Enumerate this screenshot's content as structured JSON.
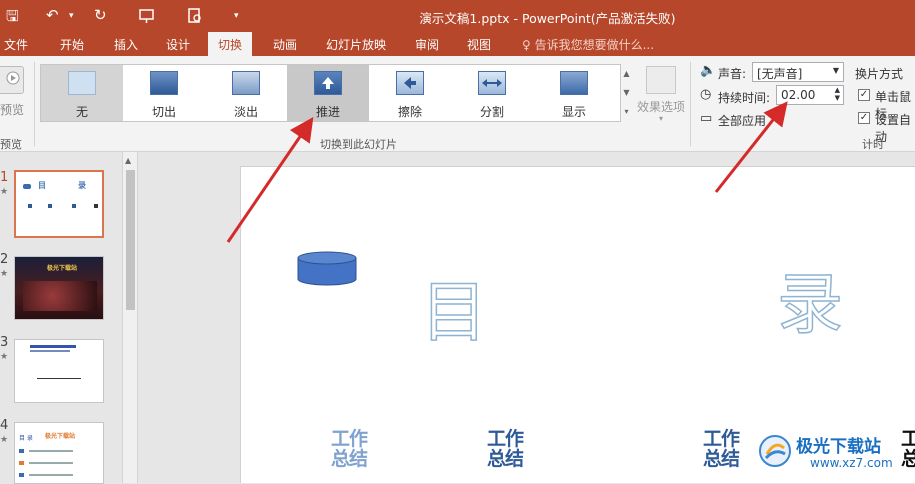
{
  "titlebar": {
    "title": "演示文稿1.pptx - PowerPoint(产品激活失败)",
    "quick_access": {
      "save": "🖫",
      "undo": "↶",
      "undo_dropdown": "▾",
      "redo": "↻",
      "customize": "▾"
    }
  },
  "tabs": [
    "文件",
    "开始",
    "插入",
    "设计",
    "切换",
    "动画",
    "幻灯片放映",
    "审阅",
    "视图"
  ],
  "active_tab": "切换",
  "tellme": "♀ 告诉我您想要做什么...",
  "ribbon": {
    "preview": {
      "label": "预览",
      "group_label": "预览"
    },
    "transitions": [
      "无",
      "切出",
      "淡出",
      "推进",
      "擦除",
      "分割",
      "显示"
    ],
    "selected_transition": "推进",
    "effect_options": "效果选项",
    "group_label": "切换到此幻灯片",
    "timing": {
      "sound_label": "声音:",
      "sound_value": "[无声音]",
      "duration_label": "持续时间:",
      "duration_value": "02.00",
      "apply_all": "全部应用",
      "advance_label": "换片方式",
      "on_click": "单击鼠标",
      "after": "设置自动",
      "group_label": "计时"
    }
  },
  "slides": [
    {
      "number": "1",
      "star": "★",
      "title_a": "目",
      "title_b": "录"
    },
    {
      "number": "2",
      "star": "★",
      "title": "极光下载站"
    },
    {
      "number": "3",
      "star": "★"
    },
    {
      "number": "4",
      "star": "★",
      "title": "极光下载站",
      "subtitle": "目 录"
    }
  ],
  "canvas": {
    "title_left": "目",
    "title_right": "录",
    "items": [
      "工作\n总结",
      "工作\n总结",
      "工作\n总结"
    ]
  },
  "watermark": {
    "name": "极光下载站",
    "url": "www.xz7.com"
  },
  "colors": {
    "accent": "#b7472a",
    "arrow": "#d42a2a"
  }
}
